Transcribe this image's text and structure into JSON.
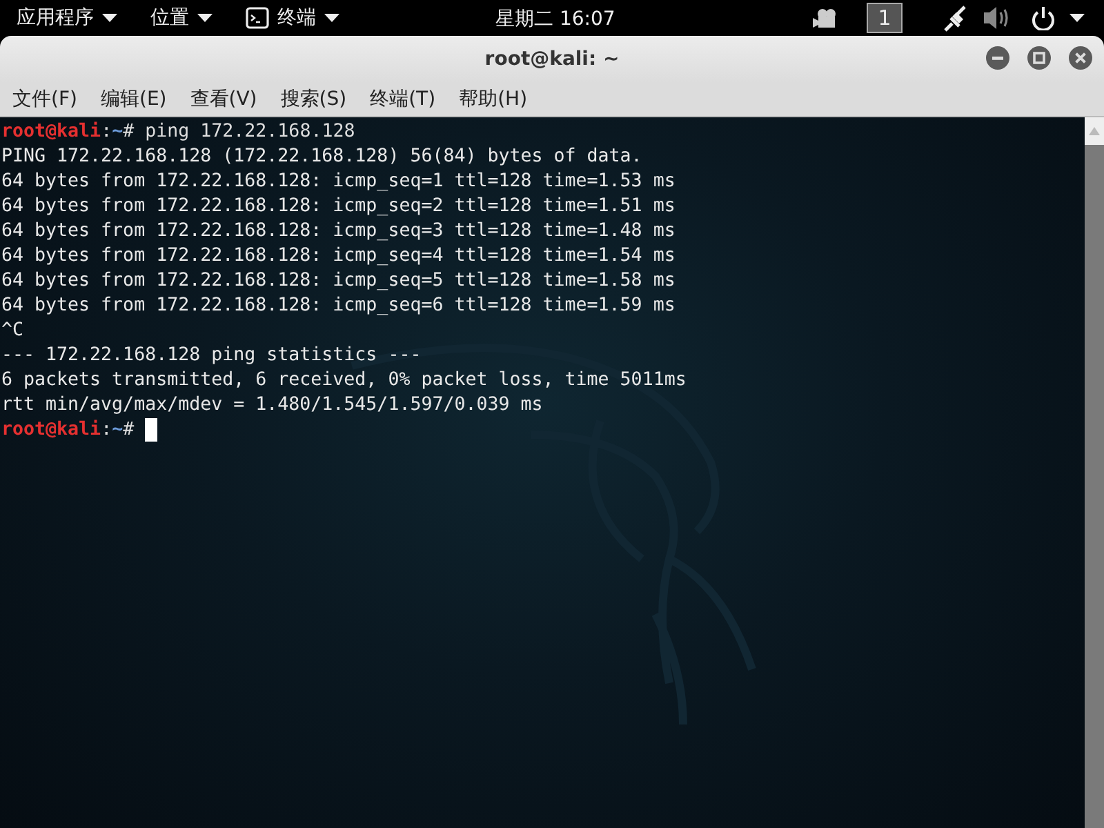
{
  "top_bar": {
    "menus": [
      {
        "label": "应用程序",
        "icon": false
      },
      {
        "label": "位置",
        "icon": false
      },
      {
        "label": "终端",
        "icon": true
      }
    ],
    "clock": "星期二 16:07",
    "workspace": "1"
  },
  "window": {
    "title": "root@kali: ~"
  },
  "menu_bar": [
    "文件(F)",
    "编辑(E)",
    "查看(V)",
    "搜索(S)",
    "终端(T)",
    "帮助(H)"
  ],
  "terminal": {
    "lines": [
      {
        "kind": "prompt",
        "user": "root@kali",
        "separator": ":",
        "path": "~",
        "symbol": "#",
        "command": "ping 172.22.168.128",
        "cursor": false
      },
      {
        "kind": "output",
        "text": "PING 172.22.168.128 (172.22.168.128) 56(84) bytes of data."
      },
      {
        "kind": "output",
        "text": "64 bytes from 172.22.168.128: icmp_seq=1 ttl=128 time=1.53 ms"
      },
      {
        "kind": "output",
        "text": "64 bytes from 172.22.168.128: icmp_seq=2 ttl=128 time=1.51 ms"
      },
      {
        "kind": "output",
        "text": "64 bytes from 172.22.168.128: icmp_seq=3 ttl=128 time=1.48 ms"
      },
      {
        "kind": "output",
        "text": "64 bytes from 172.22.168.128: icmp_seq=4 ttl=128 time=1.54 ms"
      },
      {
        "kind": "output",
        "text": "64 bytes from 172.22.168.128: icmp_seq=5 ttl=128 time=1.58 ms"
      },
      {
        "kind": "output",
        "text": "64 bytes from 172.22.168.128: icmp_seq=6 ttl=128 time=1.59 ms"
      },
      {
        "kind": "output",
        "text": "^C"
      },
      {
        "kind": "output",
        "text": "--- 172.22.168.128 ping statistics ---"
      },
      {
        "kind": "output",
        "text": "6 packets transmitted, 6 received, 0% packet loss, time 5011ms"
      },
      {
        "kind": "output",
        "text": "rtt min/avg/max/mdev = 1.480/1.545/1.597/0.039 ms"
      },
      {
        "kind": "prompt",
        "user": "root@kali",
        "separator": ":",
        "path": "~",
        "symbol": "#",
        "cursor": true
      }
    ]
  }
}
